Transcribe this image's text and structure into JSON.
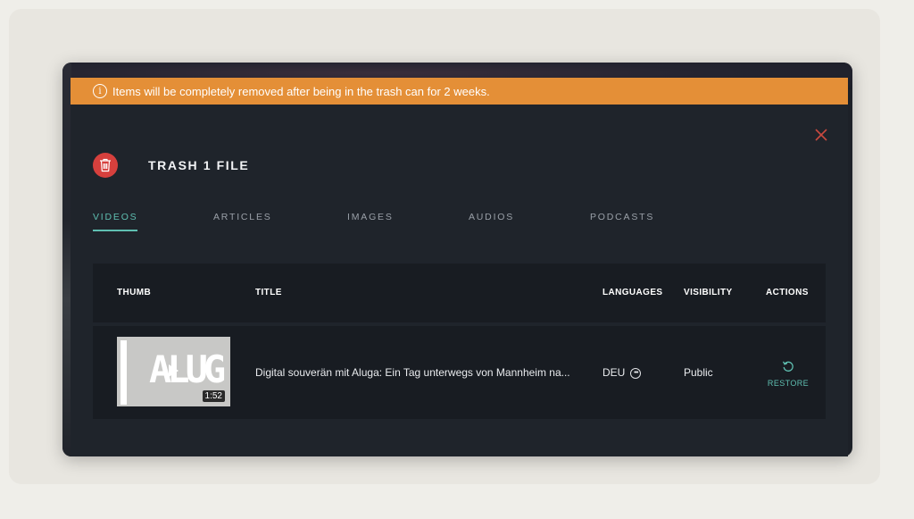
{
  "banner": {
    "text": "Items will be completely removed after being in the trash can for 2 weeks."
  },
  "modal": {
    "title": "TRASH 1 FILE"
  },
  "tabs": [
    {
      "label": "VIDEOS",
      "active": true
    },
    {
      "label": "ARTICLES",
      "active": false
    },
    {
      "label": "IMAGES",
      "active": false
    },
    {
      "label": "AUDIOS",
      "active": false
    },
    {
      "label": "PODCASTS",
      "active": false
    }
  ],
  "table": {
    "columns": [
      "THUMB",
      "TITLE",
      "LANGUAGES",
      "VISIBILITY",
      "ACTIONS"
    ],
    "rows": [
      {
        "thumb_text": "ALUG",
        "duration": "1:52",
        "title": "Digital souverän mit Aluga: Ein Tag unterwegs von Mannheim na...",
        "language": "DEU",
        "visibility": "Public",
        "action": "RESTORE"
      }
    ]
  },
  "colors": {
    "banner": "#e48f37",
    "accent": "#5fbfb1",
    "danger": "#d6403d",
    "modal_bg": "#1f242b"
  },
  "icons": [
    "info-icon",
    "close-icon",
    "trash-icon",
    "play-icon",
    "more-icon",
    "restore-icon"
  ]
}
